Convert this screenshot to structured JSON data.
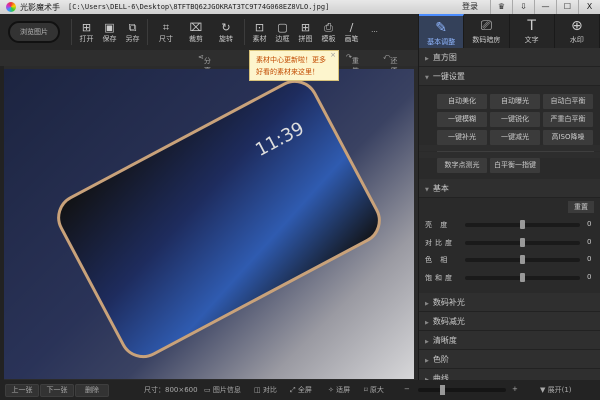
{
  "window": {
    "app": "光影魔术手",
    "path": "[C:\\Users\\DELL-6\\Desktop\\8TFTBQ62JGOKRAT3TC9T74G068EZ8VLO.jpg]",
    "login": "登录",
    "controls": [
      "♛",
      "⇩",
      "—",
      "☐",
      "X"
    ]
  },
  "toolbar": {
    "browse": "浏览图片",
    "items": [
      {
        "icon": "open-icon",
        "glyph": "⊞",
        "label": "打开"
      },
      {
        "icon": "save-icon",
        "glyph": "▣",
        "label": "保存"
      },
      {
        "icon": "save-as-icon",
        "glyph": "⧉",
        "label": "另存"
      },
      {
        "icon": "resize-icon",
        "glyph": "⌗",
        "label": "尺寸"
      },
      {
        "icon": "crop-icon",
        "glyph": "⌧",
        "label": "裁剪"
      },
      {
        "icon": "rotate-icon",
        "glyph": "↻",
        "label": "旋转"
      },
      {
        "icon": "material-icon",
        "glyph": "⊡",
        "label": "素材"
      },
      {
        "icon": "frame-icon",
        "glyph": "▢",
        "label": "边框"
      },
      {
        "icon": "collage-icon",
        "glyph": "⊞",
        "label": "拼图"
      },
      {
        "icon": "template-icon",
        "glyph": "⎙",
        "label": "模板"
      },
      {
        "icon": "brush-icon",
        "glyph": "∕",
        "label": "画笔"
      }
    ],
    "more": "···"
  },
  "row2": {
    "share": "分享",
    "redo": "重做",
    "restore": "还原"
  },
  "tooltip": {
    "text": "素材中心更新啦！更多好看的素材来这里！",
    "close": "×"
  },
  "canvas": {
    "clock": "11:39"
  },
  "bottom": {
    "prev": "上一张",
    "next": "下一张",
    "delete": "删除",
    "size": "尺寸：800×600",
    "info": "图片信息",
    "compare": "对比",
    "fullscreen": "全屏",
    "fit": "适屏",
    "original": "原大",
    "minus": "−",
    "plus": "+",
    "expand": "展开(1)"
  },
  "side": {
    "tabs": [
      {
        "icon": "adjust-icon",
        "glyph": "✎",
        "label": "基本调整"
      },
      {
        "icon": "darkroom-icon",
        "glyph": "⎚",
        "label": "数码暗房"
      },
      {
        "icon": "text-icon",
        "glyph": "T",
        "label": "文字"
      },
      {
        "icon": "watermark-icon",
        "glyph": "⊕",
        "label": "水印"
      }
    ],
    "histogram": "直方图",
    "oneclick": "一键设置",
    "buttons": [
      "自动美化",
      "自动曝光",
      "自动白平衡",
      "一键模糊",
      "一键锐化",
      "严重白平衡",
      "一键补光",
      "一键减光",
      "高ISO降噪"
    ],
    "buttons2": [
      "数字点测光",
      "白平衡一指键"
    ],
    "basic": "基本",
    "reset": "重置",
    "sliders": [
      {
        "label": "亮  度",
        "value": 0
      },
      {
        "label": "对比度",
        "value": 0
      },
      {
        "label": "色  相",
        "value": 0
      },
      {
        "label": "饱和度",
        "value": 0
      }
    ],
    "sections": [
      "数码补光",
      "数码减光",
      "清晰度",
      "色阶",
      "曲线"
    ]
  }
}
